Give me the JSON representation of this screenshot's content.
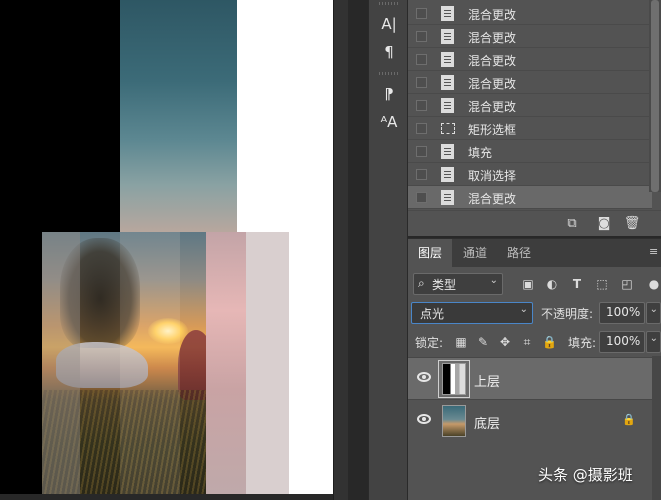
{
  "history": {
    "items": [
      {
        "label": "混合更改",
        "icon": "document-icon"
      },
      {
        "label": "混合更改",
        "icon": "document-icon"
      },
      {
        "label": "混合更改",
        "icon": "document-icon"
      },
      {
        "label": "混合更改",
        "icon": "document-icon"
      },
      {
        "label": "混合更改",
        "icon": "document-icon"
      },
      {
        "label": "矩形选框",
        "icon": "rect-marquee-icon"
      },
      {
        "label": "填充",
        "icon": "document-icon"
      },
      {
        "label": "取消选择",
        "icon": "document-icon"
      },
      {
        "label": "混合更改",
        "icon": "document-icon",
        "selected": true
      }
    ],
    "footer_icons": [
      "new-document-from-state-icon",
      "camera-snapshot-icon",
      "trash-icon"
    ]
  },
  "tool_strip": {
    "icons": [
      "character-panel-icon",
      "paragraph-panel-icon",
      "paragraph-styles-icon",
      "character-styles-icon"
    ],
    "glyphs": [
      "A|",
      "¶",
      "⁋",
      "ᴬA"
    ]
  },
  "layers_panel": {
    "tabs": [
      {
        "label": "图层",
        "active": true
      },
      {
        "label": "通道",
        "active": false
      },
      {
        "label": "路径",
        "active": false
      }
    ],
    "filter": {
      "label": "类型",
      "search_glyph": "⌕"
    },
    "filter_icons": [
      "image-filter-icon",
      "adjustment-filter-icon",
      "type-filter-icon",
      "shape-filter-icon",
      "smart-object-filter-icon"
    ],
    "blend_mode": "点光",
    "opacity_label": "不透明度:",
    "opacity_value": "100%",
    "lock_label": "锁定:",
    "lock_icons": [
      "lock-transparent-icon",
      "lock-image-icon",
      "lock-position-icon",
      "lock-artboard-icon",
      "lock-all-icon"
    ],
    "fill_label": "填充:",
    "fill_value": "100%",
    "layers": [
      {
        "name": "上层",
        "visible": true,
        "selected": true,
        "locked": false
      },
      {
        "name": "底层",
        "visible": true,
        "selected": false,
        "locked": true
      }
    ]
  },
  "watermark": "头条 @摄影班",
  "colors": {
    "panel_bg": "#535353",
    "workspace_bg": "#282828",
    "selection_highlight": "#696969",
    "focus_border": "#4a86c8"
  }
}
